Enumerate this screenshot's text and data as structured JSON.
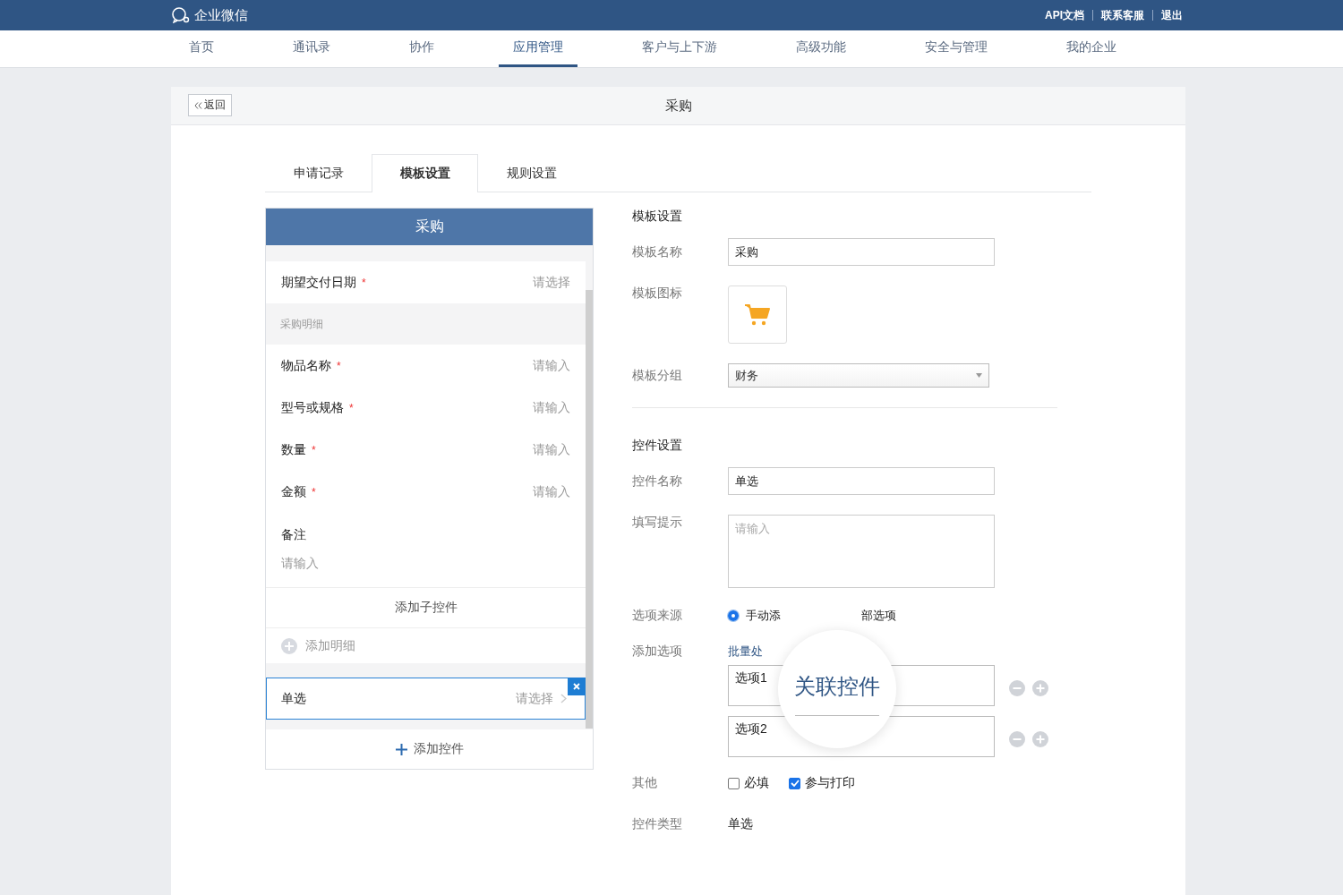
{
  "top_bar": {
    "logo": "企业微信",
    "links": [
      "API文档",
      "联系客服",
      "退出"
    ]
  },
  "nav": [
    {
      "label": "首页",
      "selected": false
    },
    {
      "label": "通讯录",
      "selected": false
    },
    {
      "label": "协作",
      "selected": false
    },
    {
      "label": "应用管理",
      "selected": true
    },
    {
      "label": "客户与上下游",
      "selected": false
    },
    {
      "label": "高级功能",
      "selected": false
    },
    {
      "label": "安全与管理",
      "selected": false
    },
    {
      "label": "我的企业",
      "selected": false
    }
  ],
  "card": {
    "back": "返回",
    "title": "采购"
  },
  "tabs": [
    {
      "label": "申请记录",
      "selected": false
    },
    {
      "label": "模板设置",
      "selected": true
    },
    {
      "label": "规则设置",
      "selected": false
    }
  ],
  "preview": {
    "title": "采购",
    "items": [
      {
        "kind": "field",
        "label": "期望交付日期",
        "required_mark": "*",
        "hint": "请选择",
        "selected": false
      },
      {
        "kind": "section",
        "label": "采购明细"
      },
      {
        "kind": "field",
        "label": "物品名称",
        "required_mark": "*",
        "hint": "请输入",
        "selected": false
      },
      {
        "kind": "field",
        "label": "型号或规格",
        "required_mark": "*",
        "hint": "请输入",
        "selected": false
      },
      {
        "kind": "field",
        "label": "数量",
        "required_mark": "*",
        "hint": "请输入",
        "selected": false
      },
      {
        "kind": "field",
        "label": "金额",
        "required_mark": "*",
        "hint": "请输入",
        "selected": false
      },
      {
        "kind": "note",
        "label": "备注",
        "hint": "请输入"
      },
      {
        "kind": "sub_action",
        "label": "添加子控件"
      },
      {
        "kind": "add_detail",
        "label": "添加明细"
      },
      {
        "kind": "gap"
      },
      {
        "kind": "field",
        "label": "单选",
        "hint": "请选择",
        "selected": true
      }
    ],
    "add_control": "添加控件"
  },
  "template_settings": {
    "heading": "模板设置",
    "name_label": "模板名称",
    "name_value": "采购",
    "icon_label": "模板图标",
    "group_label": "模板分组",
    "group_value": "财务"
  },
  "control_settings": {
    "heading": "控件设置",
    "name_label": "控件名称",
    "name_value": "单选",
    "hint_label": "填写提示",
    "hint_placeholder": "请输入",
    "source_label": "选项来源",
    "source_choice": {
      "label": "手动添",
      "selected": true
    },
    "source_trailing": "部选项",
    "options_label": "添加选项",
    "batch_link": "批量处",
    "options": [
      "选项1",
      "选项2"
    ],
    "other_label": "其他",
    "checkboxes": [
      {
        "label": "必填",
        "checked": false
      },
      {
        "label": "参与打印",
        "checked": true
      }
    ],
    "type_label": "控件类型",
    "type_value": "单选"
  },
  "magnifier": {
    "text": "关联控件"
  }
}
